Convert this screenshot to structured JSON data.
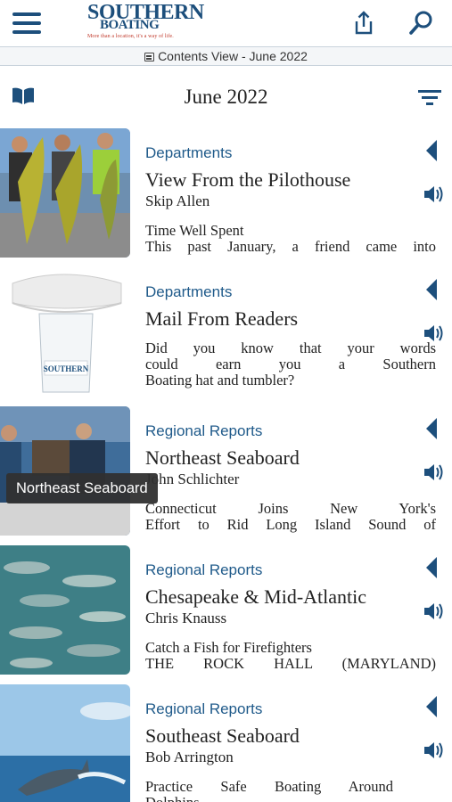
{
  "header": {
    "logo_main_line1": "SOUTHERN",
    "logo_main_line2": "BOATING",
    "logo_tagline": "More than a location, it's a way of life."
  },
  "contents_view": {
    "label": "Contents View - June 2022"
  },
  "issue": {
    "title": "June 2022"
  },
  "articles": [
    {
      "category": "Departments",
      "title": "View From the Pilothouse",
      "author": "Skip Allen",
      "excerpt_line1": "Time Well Spent",
      "excerpt_line2": "This past January, a friend came into"
    },
    {
      "category": "Departments",
      "title": "Mail From Readers",
      "author": "",
      "excerpt_line1": "Did you know that your words",
      "excerpt_line2": "could earn you a Southern",
      "excerpt_line3": "Boating hat and tumbler?"
    },
    {
      "category": "Regional Reports",
      "title": "Northeast Seaboard",
      "author": "John Schlichter",
      "excerpt_line1": "Connecticut Joins New York's",
      "excerpt_line2": "Effort to Rid Long Island Sound of"
    },
    {
      "category": "Regional Reports",
      "title": "Chesapeake & Mid-Atlantic",
      "author": "Chris Knauss",
      "excerpt_line1": "Catch a Fish for Firefighters",
      "excerpt_line2": "THE ROCK HALL (MARYLAND)"
    },
    {
      "category": "Regional Reports",
      "title": "Southeast Seaboard",
      "author": "Bob Arrington",
      "excerpt_line1": "Practice Safe Boating Around",
      "excerpt_line2": "Dolphins"
    }
  ],
  "tooltip": {
    "text": "Northeast Seaboard"
  },
  "icons": {
    "menu": "hamburger-menu-icon",
    "share": "share-icon",
    "search": "search-icon",
    "book": "book-icon",
    "filter": "filter-icon",
    "expand": "chevron-left-icon",
    "audio": "speaker-icon"
  },
  "colors": {
    "brand_blue": "#1d4f7c",
    "category_blue": "#1f5a8a",
    "tagline_red": "#c0392b"
  }
}
